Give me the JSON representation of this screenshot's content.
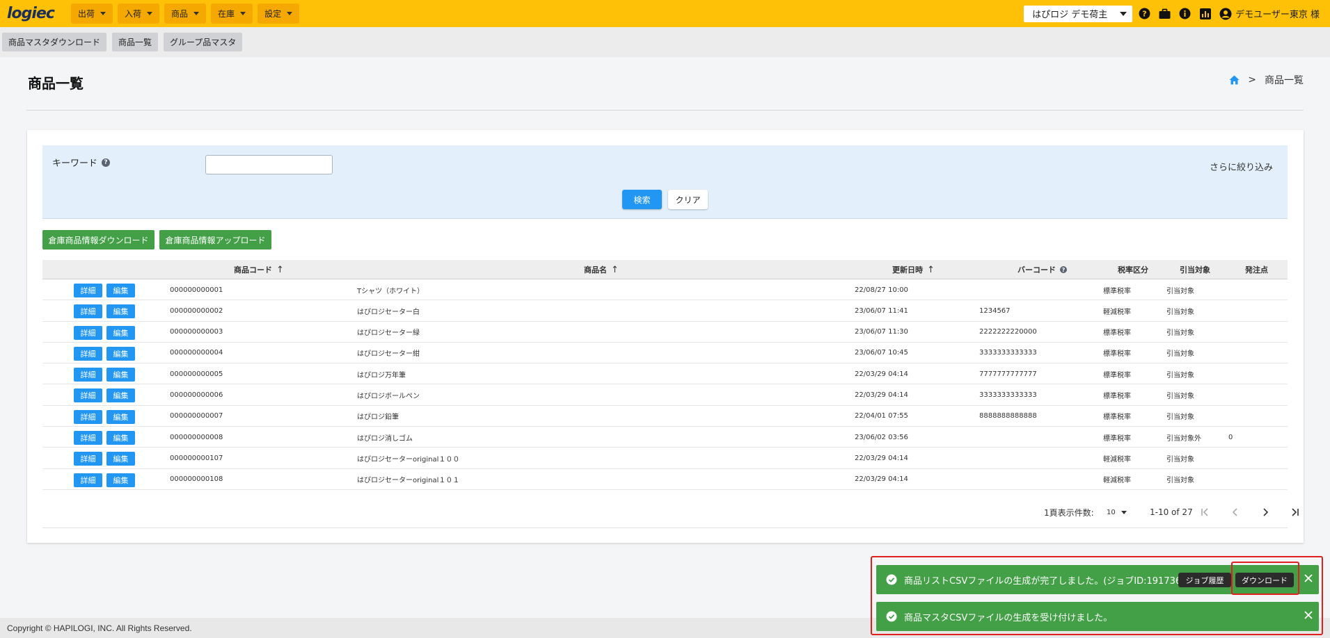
{
  "header": {
    "logo": "logiec",
    "menu": [
      "出荷",
      "入荷",
      "商品",
      "在庫",
      "設定"
    ],
    "shipper": "はぴロジ デモ荷主",
    "user": "デモユーザー東京 様"
  },
  "subnav": [
    "商品マスタダウンロード",
    "商品一覧",
    "グループ品マスタ"
  ],
  "page": {
    "title": "商品一覧",
    "breadcrumb_sep": ">",
    "breadcrumb_current": "商品一覧"
  },
  "search": {
    "keyword_label": "キーワード",
    "keyword_value": "",
    "refine": "さらに絞り込み",
    "search_button": "検索",
    "clear_button": "クリア"
  },
  "actions": {
    "download": "倉庫商品情報ダウンロード",
    "upload": "倉庫商品情報アップロード"
  },
  "table": {
    "headers": {
      "code": "商品コード",
      "name": "商品名",
      "updated": "更新日時",
      "barcode": "バーコード",
      "tax": "税率区分",
      "alloc": "引当対象",
      "reorder": "発注点"
    },
    "detail_label": "詳細",
    "edit_label": "編集",
    "rows": [
      {
        "code": "000000000001",
        "name": "Tシャツ（ホワイト）",
        "updated": "22/08/27 10:00",
        "barcode": "",
        "tax": "標準税率",
        "alloc": "引当対象",
        "reorder": ""
      },
      {
        "code": "000000000002",
        "name": "はぴロジセーター白",
        "updated": "23/06/07 11:41",
        "barcode": "1234567",
        "tax": "軽減税率",
        "alloc": "引当対象",
        "reorder": ""
      },
      {
        "code": "000000000003",
        "name": "はぴロジセーター緑",
        "updated": "23/06/07 11:30",
        "barcode": "2222222220000",
        "tax": "標準税率",
        "alloc": "引当対象",
        "reorder": ""
      },
      {
        "code": "000000000004",
        "name": "はぴロジセーター紺",
        "updated": "23/06/07 10:45",
        "barcode": "3333333333333",
        "tax": "標準税率",
        "alloc": "引当対象",
        "reorder": ""
      },
      {
        "code": "000000000005",
        "name": "はぴロジ万年筆",
        "updated": "22/03/29 04:14",
        "barcode": "7777777777777",
        "tax": "標準税率",
        "alloc": "引当対象",
        "reorder": ""
      },
      {
        "code": "000000000006",
        "name": "はぴロジボールペン",
        "updated": "22/03/29 04:14",
        "barcode": "3333333333333",
        "tax": "標準税率",
        "alloc": "引当対象",
        "reorder": ""
      },
      {
        "code": "000000000007",
        "name": "はぴロジ鉛筆",
        "updated": "22/04/01 07:55",
        "barcode": "8888888888888",
        "tax": "標準税率",
        "alloc": "引当対象",
        "reorder": ""
      },
      {
        "code": "000000000008",
        "name": "はぴロジ消しゴム",
        "updated": "23/06/02 03:56",
        "barcode": "",
        "tax": "標準税率",
        "alloc": "引当対象外",
        "reorder": "0"
      },
      {
        "code": "000000000107",
        "name": "はぴロジセーターoriginal１００",
        "updated": "22/03/29 04:14",
        "barcode": "",
        "tax": "軽減税率",
        "alloc": "引当対象",
        "reorder": ""
      },
      {
        "code": "000000000108",
        "name": "はぴロジセーターoriginal１０１",
        "updated": "22/03/29 04:14",
        "barcode": "",
        "tax": "軽減税率",
        "alloc": "引当対象",
        "reorder": ""
      }
    ]
  },
  "pagination": {
    "per_page_label": "1頁表示件数:",
    "per_page": "10",
    "range": "1-10 of 27"
  },
  "footer": "Copyright © HAPILOGI, INC. All Rights Reserved.",
  "toasts": {
    "first": "商品リストCSVファイルの生成が完了しました。(ジョブID:191736)",
    "job_history": "ジョブ履歴",
    "download": "ダウンロード",
    "second": "商品マスタCSVファイルの生成を受け付けました。"
  },
  "colors": {
    "header": "#ffc107",
    "primary": "#2196f3",
    "success": "#43a047",
    "highlight": "#e02020"
  },
  "icons": [
    "help-icon",
    "briefcase-icon",
    "info-icon",
    "chart-icon",
    "user-icon",
    "home-icon",
    "sort-up-icon",
    "check-circle-icon",
    "close-icon",
    "first-page-icon",
    "prev-page-icon",
    "next-page-icon",
    "last-page-icon"
  ]
}
